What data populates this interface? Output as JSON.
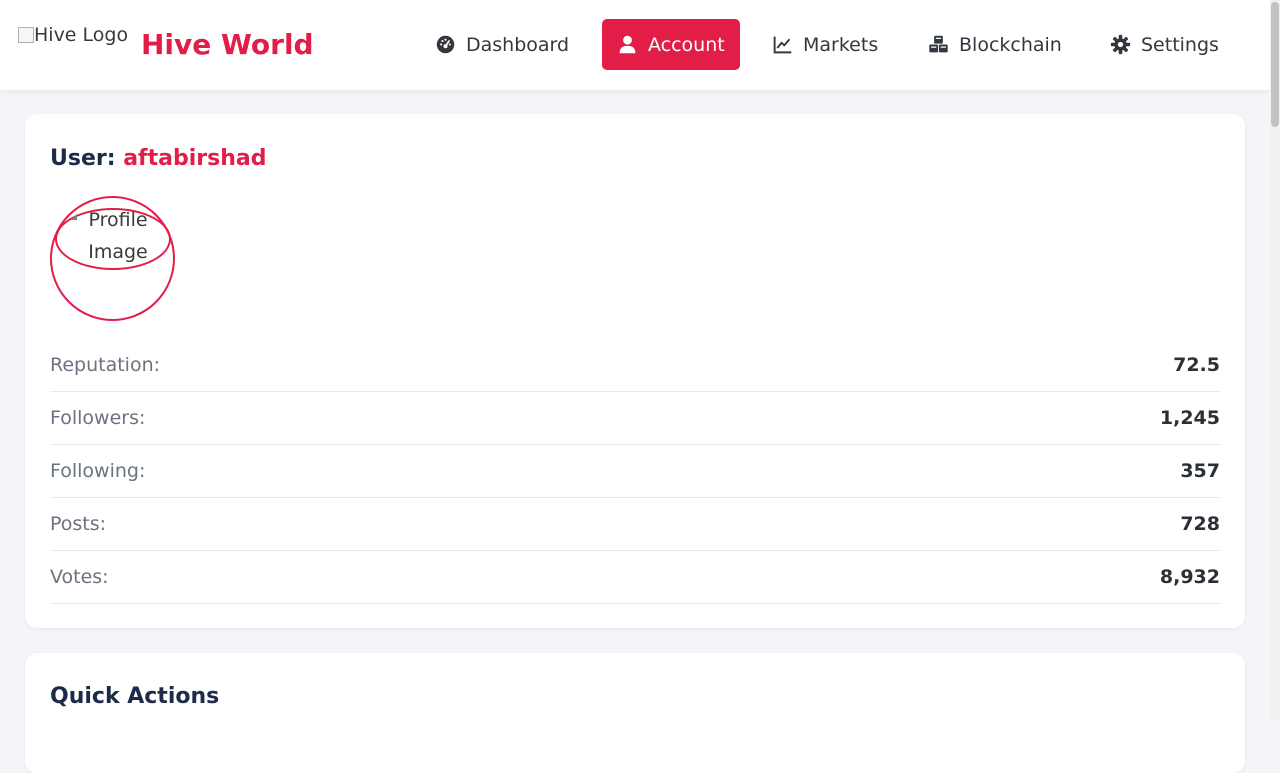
{
  "header": {
    "logo_alt": "Hive Logo",
    "brand": "Hive World",
    "nav": [
      {
        "label": "Dashboard",
        "icon": "gauge-icon",
        "active": false
      },
      {
        "label": "Account",
        "icon": "user-icon",
        "active": true
      },
      {
        "label": "Markets",
        "icon": "chart-line-icon",
        "active": false
      },
      {
        "label": "Blockchain",
        "icon": "cubes-icon",
        "active": false
      },
      {
        "label": "Settings",
        "icon": "gear-icon",
        "active": false
      }
    ]
  },
  "user": {
    "heading_prefix": "User:",
    "username": "aftabirshad",
    "profile_image_alt": "Profile Image",
    "stats": [
      {
        "label": "Reputation:",
        "value": "72.5"
      },
      {
        "label": "Followers:",
        "value": "1,245"
      },
      {
        "label": "Following:",
        "value": "357"
      },
      {
        "label": "Posts:",
        "value": "728"
      },
      {
        "label": "Votes:",
        "value": "8,932"
      }
    ]
  },
  "quick_actions": {
    "title": "Quick Actions"
  },
  "colors": {
    "accent": "#e11d48",
    "heading": "#1e2a4a",
    "background": "#f4f5f9"
  }
}
